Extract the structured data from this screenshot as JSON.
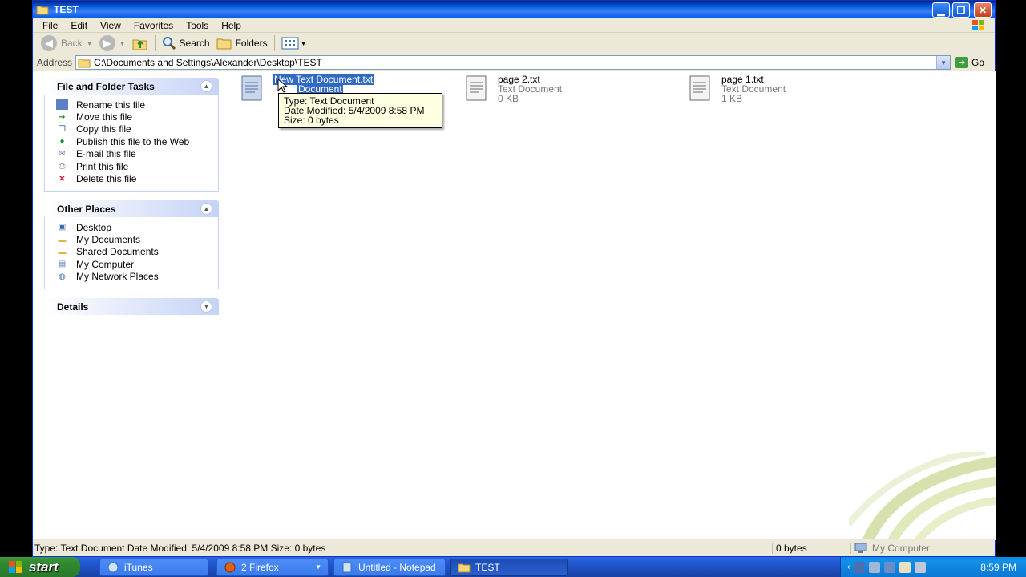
{
  "window": {
    "title": "TEST",
    "menu": [
      "File",
      "Edit",
      "View",
      "Favorites",
      "Tools",
      "Help"
    ]
  },
  "toolbar": {
    "back": "Back",
    "search": "Search",
    "folders": "Folders"
  },
  "address": {
    "label": "Address",
    "path": "C:\\Documents and Settings\\Alexander\\Desktop\\TEST",
    "go": "Go"
  },
  "tasks": {
    "file_folder": {
      "title": "File and Folder Tasks",
      "items": [
        "Rename this file",
        "Move this file",
        "Copy this file",
        "Publish this file to the Web",
        "E-mail this file",
        "Print this file",
        "Delete this file"
      ]
    },
    "other_places": {
      "title": "Other Places",
      "items": [
        "Desktop",
        "My Documents",
        "Shared Documents",
        "My Computer",
        "My Network Places"
      ]
    },
    "details": {
      "title": "Details"
    }
  },
  "files": [
    {
      "name": "New Text Document.txt",
      "type": "Document",
      "size": ""
    },
    {
      "name": "page 2.txt",
      "type": "Text Document",
      "size": "0 KB"
    },
    {
      "name": "page 1.txt",
      "type": "Text Document",
      "size": "1 KB"
    }
  ],
  "tooltip": {
    "line1": "Type: Text Document",
    "line2": "Date Modified: 5/4/2009 8:58 PM",
    "line3": "Size: 0 bytes"
  },
  "status": {
    "text": "Type: Text Document Date Modified: 5/4/2009 8:58 PM Size: 0 bytes",
    "size": "0 bytes",
    "zone": "My Computer"
  },
  "taskbar": {
    "start": "start",
    "items": [
      "iTunes",
      "2 Firefox",
      "Untitled - Notepad",
      "TEST"
    ],
    "clock": "8:59 PM"
  },
  "colors": {
    "selection": "#316ac5",
    "titlebar": "#0058e6",
    "taskbar": "#245edb",
    "start": "#318a31",
    "tooltip_bg": "#ffffe1"
  }
}
